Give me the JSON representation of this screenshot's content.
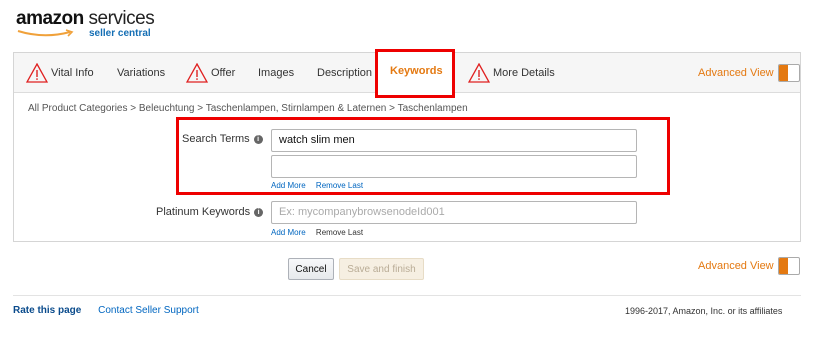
{
  "logo": {
    "brand": "amazon",
    "services": "services",
    "tagline": "seller central"
  },
  "tabs": [
    {
      "label": "Vital Info",
      "warning": true
    },
    {
      "label": "Variations",
      "warning": false
    },
    {
      "label": "Offer",
      "warning": true
    },
    {
      "label": "Images",
      "warning": false
    },
    {
      "label": "Description",
      "warning": false
    },
    {
      "label": "Keywords",
      "warning": false,
      "active": true
    },
    {
      "label": "More Details",
      "warning": true
    }
  ],
  "advanced_view_label": "Advanced View",
  "breadcrumb": "All Product Categories > Beleuchtung > Taschenlampen, Stirnlampen & Laternen > Taschenlampen",
  "search_terms": {
    "label": "Search Terms",
    "values": [
      "watch slim men",
      ""
    ],
    "add_more": "Add More",
    "remove_last": "Remove Last"
  },
  "platinum_keywords": {
    "label": "Platinum Keywords",
    "placeholder": "Ex: mycompanybrowsenodeId001",
    "add_more": "Add More",
    "remove_last": "Remove Last"
  },
  "buttons": {
    "cancel": "Cancel",
    "save": "Save and finish"
  },
  "footer": {
    "rate": "Rate this page",
    "contact": "Contact Seller Support",
    "copyright": "1996-2017, Amazon, Inc. or its affiliates"
  },
  "colors": {
    "accent": "#e47911",
    "link": "#0066c0",
    "highlight": "#ee0000"
  }
}
